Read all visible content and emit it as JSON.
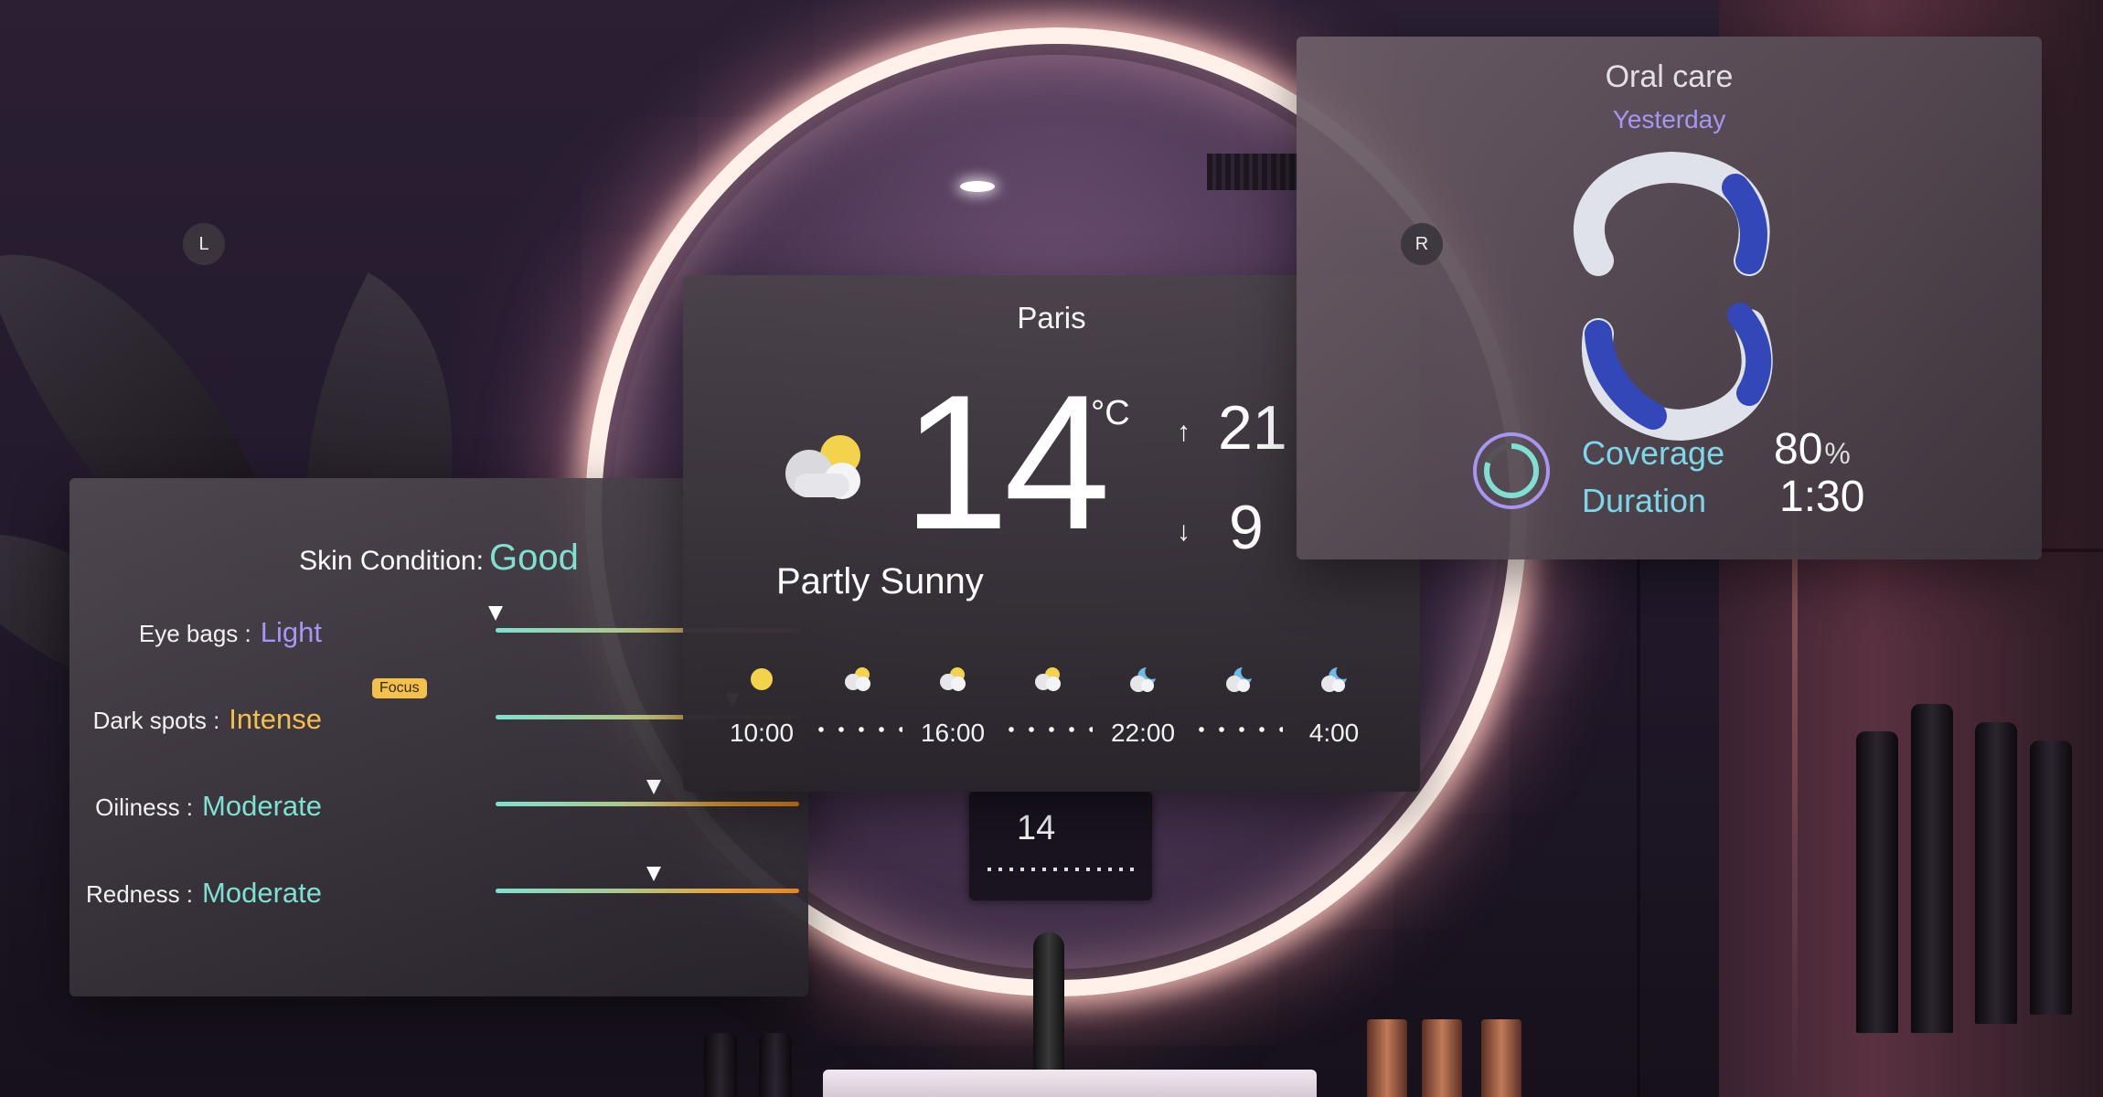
{
  "skin": {
    "title": "Skin Condition:",
    "value": "Good",
    "focus_badge": "Focus",
    "metrics": [
      {
        "label": "Eye bags :",
        "value": "Light",
        "level": 0.0,
        "color": "#a696f2"
      },
      {
        "label": "Dark spots :",
        "value": "Intense",
        "level": 0.78,
        "color": "#f3c04c"
      },
      {
        "label": "Oiliness :",
        "value": "Moderate",
        "level": 0.52,
        "color": "#7fe0d2"
      },
      {
        "label": "Redness :",
        "value": "Moderate",
        "level": 0.52,
        "color": "#7fe0d2"
      }
    ]
  },
  "weather": {
    "city": "Paris",
    "temperature": "14",
    "unit": "°C",
    "high": "21",
    "low": "9",
    "condition": "Partly Sunny",
    "icon": "partly-sunny-icon",
    "hourly": [
      {
        "time": "10:00",
        "icon": "sun-icon"
      },
      {
        "time": "16:00",
        "icon": "partly-sunny-icon"
      },
      {
        "time": "22:00",
        "icon": "cloud-moon-icon"
      },
      {
        "time": "4:00",
        "icon": "cloud-moon-icon"
      }
    ],
    "mid_icons": [
      "partly-sunny-icon",
      "partly-sunny-icon",
      "cloud-moon-icon"
    ]
  },
  "oral": {
    "title": "Oral care",
    "subtitle": "Yesterday",
    "left_label": "L",
    "right_label": "R",
    "coverage_label": "Coverage",
    "coverage_value": "80",
    "coverage_unit": "%",
    "duration_label": "Duration",
    "duration_value": "1:30"
  },
  "colors": {
    "accent_teal": "#7fe0d2",
    "accent_purple": "#a696f2",
    "accent_orange": "#e8841d",
    "focus_yellow": "#f3c04c",
    "missed_blue": "#3347b8"
  }
}
